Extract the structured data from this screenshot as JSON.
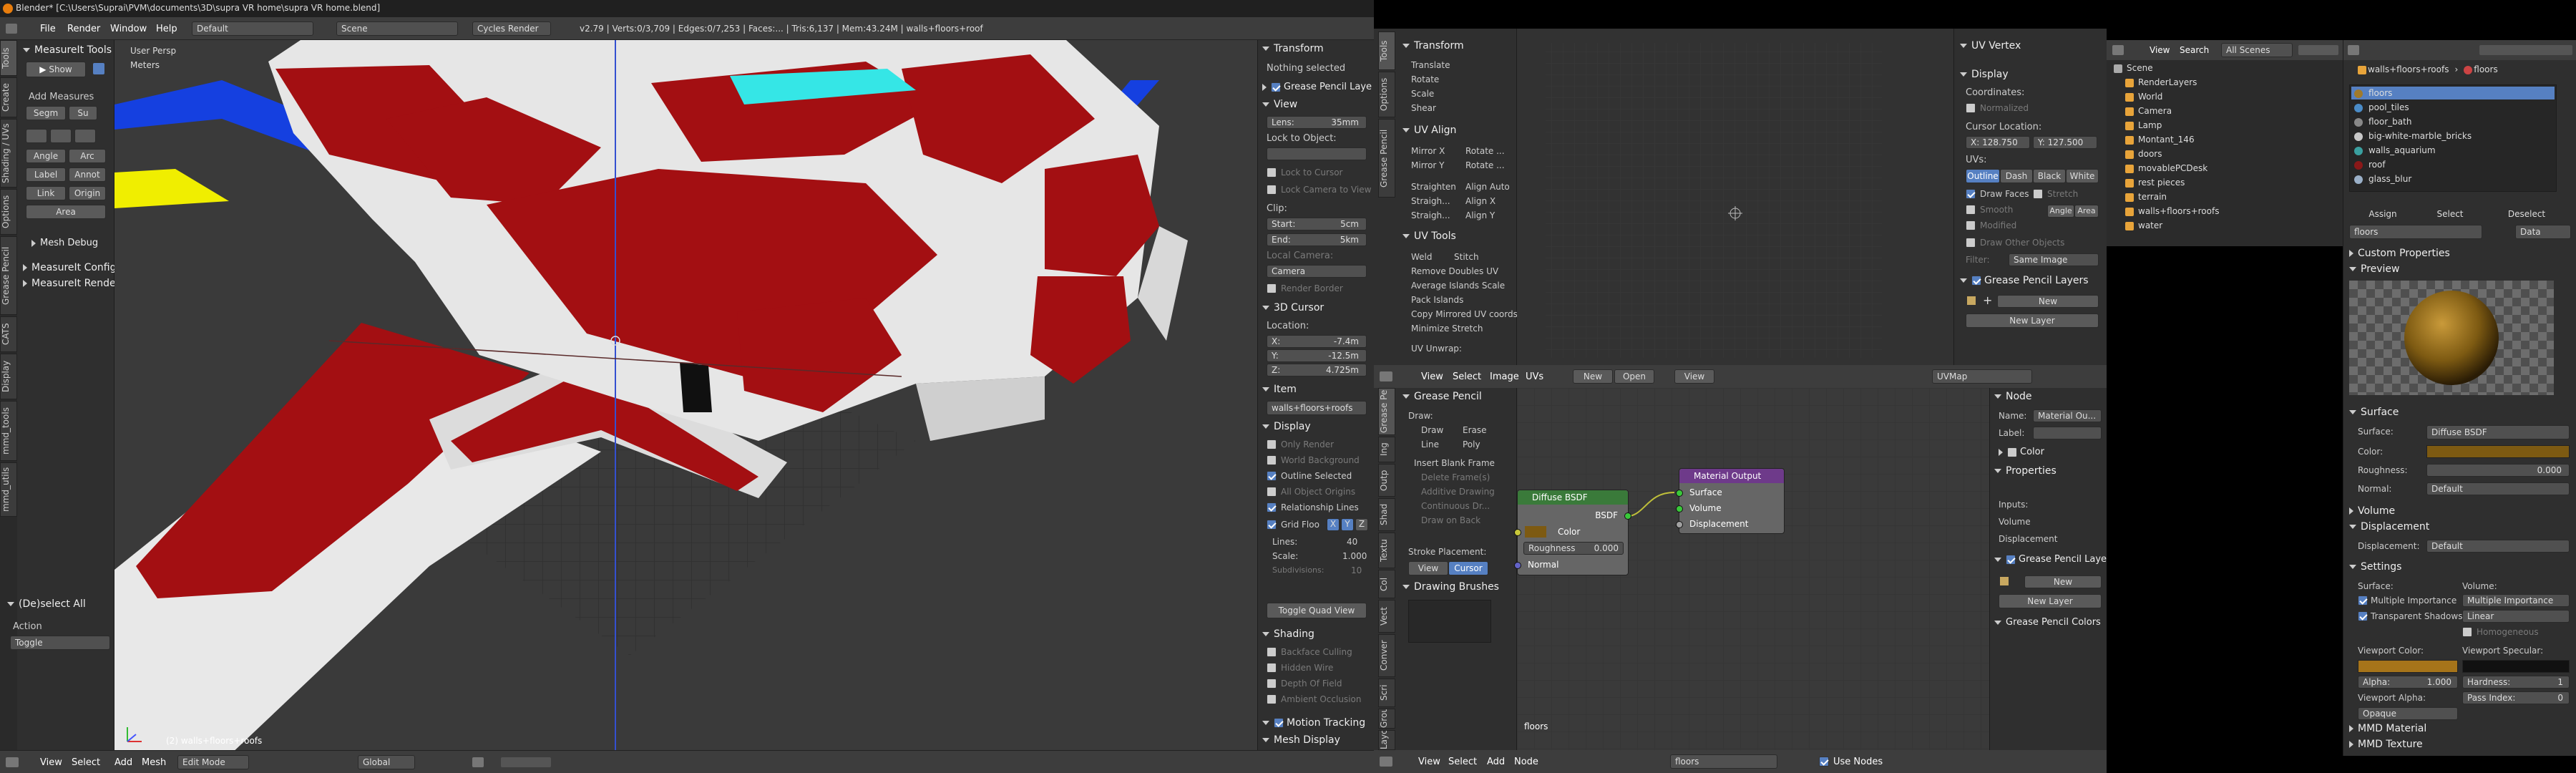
{
  "title_bar": {
    "title": "Blender* [C:\\Users\\Suprai\\PVM\\documents\\3D\\supra VR home\\supra VR home.blend]"
  },
  "info_header": {
    "menus": [
      "File",
      "Render",
      "Window",
      "Help"
    ],
    "screen": "Default",
    "scene": "Scene",
    "engine": "Cycles Render",
    "stats": "v2.79 | Verts:0/3,709 | Edges:0/7,253 | Faces:... | Tris:6,137 | Mem:43.24M | walls+floors+roof"
  },
  "tool_shelf": {
    "tabs": [
      "Tools",
      "Create",
      "Shading / UVs",
      "Options",
      "Grease Pencil",
      "CATS",
      "Display",
      "mmd_tools",
      "mmd_utils"
    ],
    "measureit_title": "MeasureIt Tools",
    "show_label": "Show",
    "add_measures": "Add Measures",
    "segm": "Segm",
    "su": "Su",
    "angle": "Angle",
    "arc": "Arc",
    "label": "Label",
    "annot": "Annot",
    "link": "Link",
    "origin": "Origin",
    "area": "Area",
    "mesh_debug": "Mesh Debug",
    "measureit_config": "MeasureIt Configu",
    "measureit_render": "MeasureIt Render",
    "operator_title": "(De)select All",
    "action_label": "Action",
    "action_value": "Toggle"
  },
  "viewport": {
    "view_name": "User Persp",
    "units": "Meters",
    "object_info": "(2) walls+floors+roofs",
    "header": [
      "View",
      "Select",
      "Add",
      "Mesh"
    ],
    "mode": "Edit Mode",
    "pivot": "Global"
  },
  "properties": {
    "transform_title": "Transform",
    "nothing_selected": "Nothing selected",
    "grease_layer": "Grease Pencil Laye",
    "view_title": "View",
    "lens_label": "Lens:",
    "lens_value": "35mm",
    "lock_to_object": "Lock to Object:",
    "lock_to_cursor": "Lock to Cursor",
    "lock_camera": "Lock Camera to View",
    "clip": "Clip:",
    "clip_start_label": "Start:",
    "clip_start": "5cm",
    "clip_end_label": "End:",
    "clip_end": "5km",
    "local_camera": "Local Camera:",
    "camera": "Camera",
    "render_border": "Render Border",
    "cursor_title": "3D Cursor",
    "location": "Location:",
    "cx_label": "X:",
    "cx": "-7.4m",
    "cy_label": "Y:",
    "cy": "-12.5m",
    "cz_label": "Z:",
    "cz": "4.725m",
    "item_title": "Item",
    "item_name": "walls+floors+roofs",
    "display_title": "Display",
    "only_render": "Only Render",
    "world_background": "World Background",
    "outline_selected": "Outline Selected",
    "all_object_origins": "All Object Origins",
    "relationship_lines": "Relationship Lines",
    "grid_floor": "Grid Floo",
    "axes": [
      "X",
      "Y",
      "Z"
    ],
    "lines_label": "Lines:",
    "lines_value": "40",
    "scale_label": "Scale:",
    "scale_value": "1.000",
    "subdiv_label": "Subdivisions:",
    "subdiv_value": "10",
    "toggle_quad": "Toggle Quad View",
    "shading_title": "Shading",
    "backface": "Backface Culling",
    "hidden_wire": "Hidden Wire",
    "depth_of_field": "Depth Of Field",
    "ambient_occlusion": "Ambient Occlusion",
    "motion_tracking": "Motion Tracking",
    "mesh_display": "Mesh Display"
  },
  "uv_tools": {
    "tabs": [
      "Tools",
      "Options",
      "Grease Pencil"
    ],
    "transform_title": "Transform",
    "translate": "Translate",
    "rotate": "Rotate",
    "scale": "Scale",
    "shear": "Shear",
    "uv_align_title": "UV Align",
    "mirror_x": "Mirror X",
    "mirror_y": "Mirror Y",
    "rotate_a": "Rotate ...",
    "rotate_b": "Rotate ...",
    "straighten": "Straighten",
    "straight1": "Straigh...",
    "straight2": "Straigh...",
    "align_auto": "Align Auto",
    "align_x": "Align X",
    "align_y": "Align Y",
    "uv_tools_title": "UV Tools",
    "weld": "Weld",
    "stitch": "Stitch",
    "remove_doubles": "Remove Doubles UV",
    "average_islands": "Average Islands Scale",
    "pack_islands": "Pack Islands",
    "copy_mirrored": "Copy Mirrored UV coords",
    "minimize_stretch": "Minimize Stretch",
    "uv_unwrap": "UV Unwrap:"
  },
  "uv_props": {
    "uv_vertex": "UV Vertex",
    "display": "Display",
    "coordinates": "Coordinates:",
    "normalized": "Normalized",
    "cursor_location": "Cursor Location:",
    "cur_x": "X: 128.750",
    "cur_y": "Y: 127.500",
    "uvs": "UVs:",
    "uv_modes": [
      "Outline",
      "Dash",
      "Black",
      "White"
    ],
    "draw_faces": "Draw Faces",
    "stretch": "Stretch",
    "smooth": "Smooth",
    "angle": "Angle",
    "area": "Area",
    "modified": "Modified",
    "draw_other": "Draw Other Objects",
    "filter": "Filter:",
    "same_image": "Same Image",
    "gp_layers": "Grease Pencil Layers",
    "new": "New",
    "new_layer": "New Layer"
  },
  "image_header": {
    "items": [
      "View",
      "Select",
      "Image",
      "UVs"
    ],
    "new": "New",
    "open": "Open",
    "view": "View",
    "uvmap": "UVMap"
  },
  "node_tools": {
    "tabs": [
      "Grease Pe",
      "Ing",
      "Outp",
      "Shad",
      "Textu",
      "Col",
      "Vect",
      "Conver",
      "Scri",
      "Grou",
      "Layo"
    ],
    "grease_pencil": "Grease Pencil",
    "draw": "Draw:",
    "draw_btn": "Draw",
    "erase_btn": "Erase",
    "line_btn": "Line",
    "poly_btn": "Poly",
    "insert_blank": "Insert Blank Frame",
    "delete_frames": "Delete Frame(s)",
    "additive": "Additive Drawing",
    "continuous": "Continuous Dr...",
    "draw_on_back": "Draw on Back",
    "stroke_placement": "Stroke Placement:",
    "view": "View",
    "cursor": "Cursor",
    "drawing_brushes": "Drawing Brushes"
  },
  "node_editor": {
    "material_name": "floors",
    "diffuse": {
      "title": "Diffuse BSDF",
      "out": "BSDF",
      "color": "Color",
      "roughness": "Roughness",
      "roughness_val": "0.000",
      "normal": "Normal"
    },
    "output": {
      "title": "Material Output",
      "surface": "Surface",
      "volume": "Volume",
      "displacement": "Displacement"
    },
    "header": [
      "View",
      "Select",
      "Add",
      "Node"
    ],
    "use_nodes": "Use Nodes"
  },
  "node_props": {
    "node": "Node",
    "name_label": "Name:",
    "name_value": "Material Ou...",
    "label_label": "Label:",
    "color": "Color",
    "properties": "Properties",
    "inputs": "Inputs:",
    "volume": "Volume",
    "displacement": "Displacement",
    "gp_layers": "Grease Pencil Layers",
    "new": "New",
    "new_layer": "New Layer",
    "gp_colors": "Grease Pencil Colors"
  },
  "outliner": {
    "header": [
      "View",
      "Search"
    ],
    "filter": "All Scenes",
    "items": [
      {
        "label": "Scene",
        "depth": 0
      },
      {
        "label": "RenderLayers",
        "depth": 1
      },
      {
        "label": "World",
        "depth": 1
      },
      {
        "label": "Camera",
        "depth": 1
      },
      {
        "label": "Lamp",
        "depth": 1
      },
      {
        "label": "Montant_146",
        "depth": 1
      },
      {
        "label": "doors",
        "depth": 1
      },
      {
        "label": "movablePCDesk",
        "depth": 1
      },
      {
        "label": "rest pieces",
        "depth": 1
      },
      {
        "label": "terrain",
        "depth": 1
      },
      {
        "label": "walls+floors+roofs",
        "depth": 1
      },
      {
        "label": "water",
        "depth": 1
      }
    ]
  },
  "material": {
    "object": "walls+floors+roofs",
    "material": "floors",
    "slots": [
      "floors",
      "pool_tiles",
      "floor_bath",
      "big-white-marble_bricks",
      "walls_aquarium",
      "roof",
      "glass_blur"
    ],
    "slot_colors": [
      "#a07a2c",
      "#4a8cc8",
      "#888888",
      "#c8c8c8",
      "#3aa0a0",
      "#8a1818",
      "#9ab0c8"
    ],
    "assign": "Assign",
    "select": "Select",
    "deselect": "Deselect",
    "data": "Data",
    "custom_props": "Custom Properties",
    "preview": "Preview",
    "surface": "Surface",
    "surface_label": "Surface:",
    "surface_value": "Diffuse BSDF",
    "color_label": "Color:",
    "roughness_label": "Roughness:",
    "roughness_value": "0.000",
    "normal_label": "Normal:",
    "normal_value": "Default",
    "volume": "Volume",
    "displacement": "Displacement",
    "displacement_label": "Displacement:",
    "displacement_value": "Default",
    "settings": "Settings",
    "s_surface": "Surface:",
    "s_volume": "Volume:",
    "multiple_importance": "Multiple Importance",
    "multiple_importance2": "Multiple Importance",
    "transparent_shadows": "Transparent Shadows",
    "linear": "Linear",
    "homogeneous": "Homogeneous",
    "viewport_color": "Viewport Color:",
    "viewport_specular": "Viewport Specular:",
    "alpha_label": "Alpha:",
    "alpha_value": "1.000",
    "hardness_label": "Hardness:",
    "hardness_value": "1",
    "viewport_alpha": "Viewport Alpha:",
    "pass_index_label": "Pass Index:",
    "pass_index_value": "0",
    "opaque": "Opaque",
    "mmd_material": "MMD Material",
    "mmd_texture": "MMD Texture",
    "base_color": "#7d5a12"
  },
  "colors": {
    "accent": "#5680c2",
    "wall_red": "#a30f12",
    "water": "#35e6e6",
    "node_out_header": "#6e3a8a",
    "node_shader_header": "#3a7a3a"
  }
}
